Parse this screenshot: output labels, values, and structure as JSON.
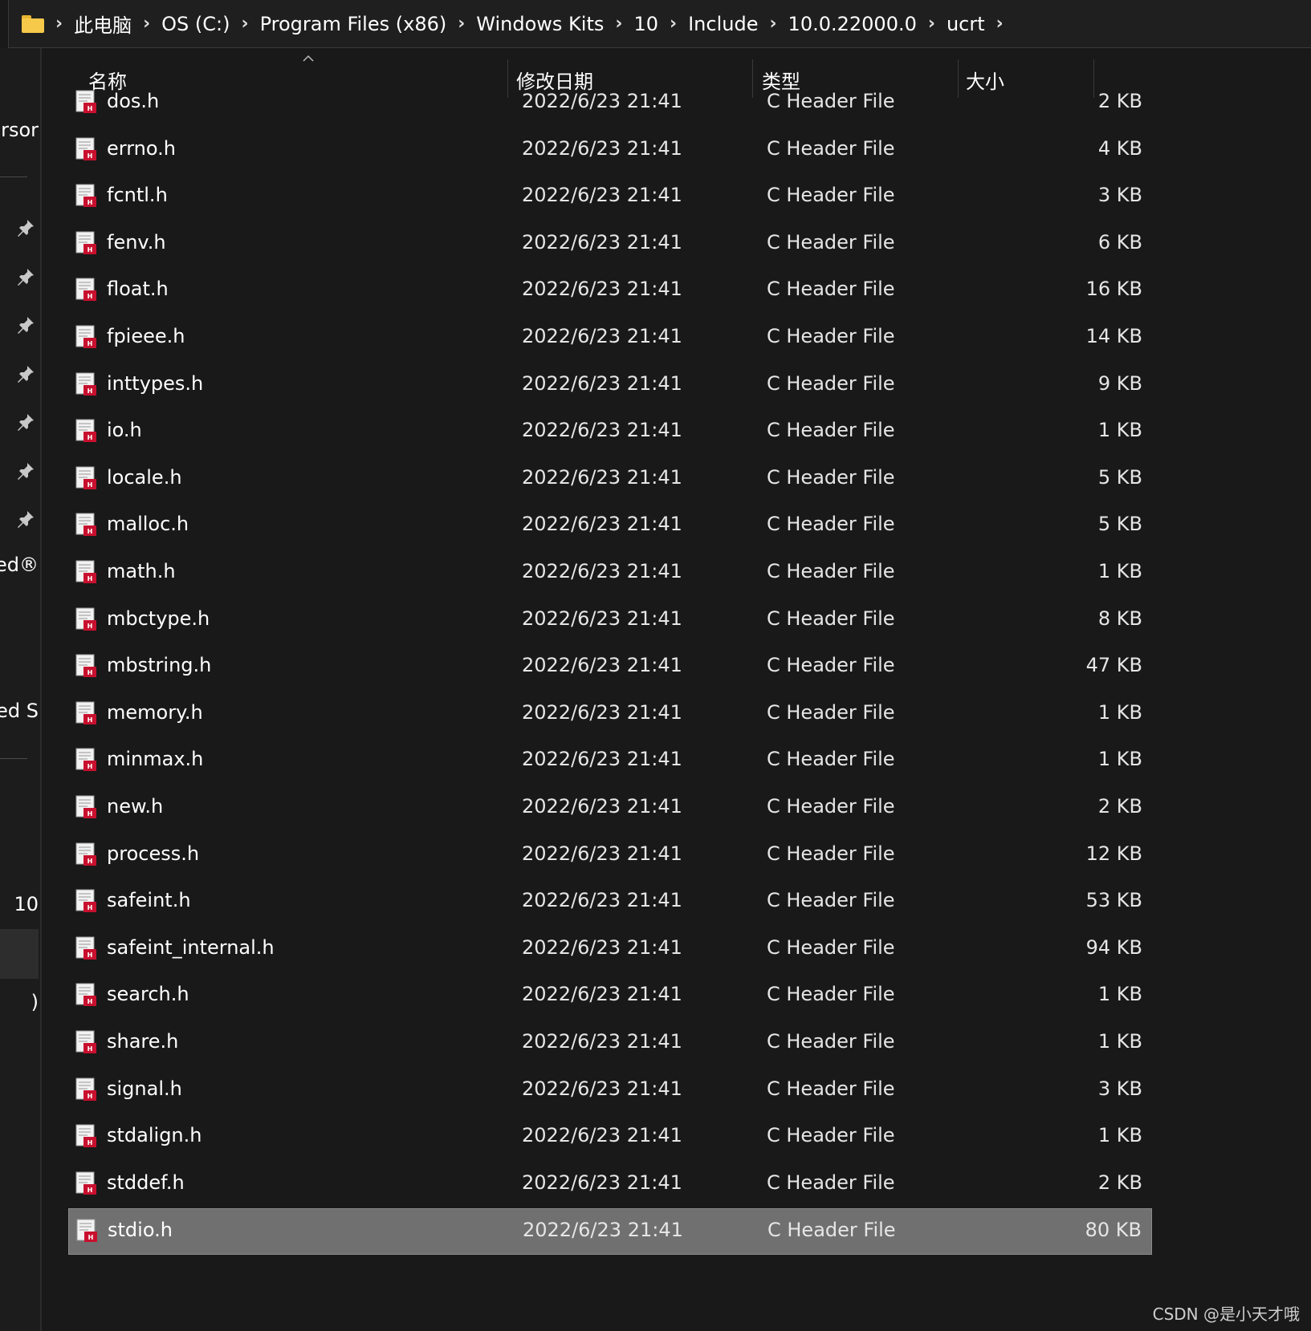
{
  "breadcrumb": [
    "此电脑",
    "OS (C:)",
    "Program Files (x86)",
    "Windows Kits",
    "10",
    "Include",
    "10.0.22000.0",
    "ucrt"
  ],
  "nav": {
    "texts": [
      "rsor",
      "ed®",
      "ed S",
      "10",
      ")"
    ],
    "pin_icons": [
      "pin-icon",
      "pin-icon",
      "pin-icon",
      "pin-icon",
      "pin-icon",
      "pin-icon",
      "pin-icon"
    ]
  },
  "columns": {
    "name": "名称",
    "date": "修改日期",
    "type": "类型",
    "size": "大小"
  },
  "files": [
    {
      "name": "dos.h",
      "date": "2022/6/23 21:41",
      "type": "C Header File",
      "size": "2 KB"
    },
    {
      "name": "errno.h",
      "date": "2022/6/23 21:41",
      "type": "C Header File",
      "size": "4 KB"
    },
    {
      "name": "fcntl.h",
      "date": "2022/6/23 21:41",
      "type": "C Header File",
      "size": "3 KB"
    },
    {
      "name": "fenv.h",
      "date": "2022/6/23 21:41",
      "type": "C Header File",
      "size": "6 KB"
    },
    {
      "name": "float.h",
      "date": "2022/6/23 21:41",
      "type": "C Header File",
      "size": "16 KB"
    },
    {
      "name": "fpieee.h",
      "date": "2022/6/23 21:41",
      "type": "C Header File",
      "size": "14 KB"
    },
    {
      "name": "inttypes.h",
      "date": "2022/6/23 21:41",
      "type": "C Header File",
      "size": "9 KB"
    },
    {
      "name": "io.h",
      "date": "2022/6/23 21:41",
      "type": "C Header File",
      "size": "1 KB"
    },
    {
      "name": "locale.h",
      "date": "2022/6/23 21:41",
      "type": "C Header File",
      "size": "5 KB"
    },
    {
      "name": "malloc.h",
      "date": "2022/6/23 21:41",
      "type": "C Header File",
      "size": "5 KB"
    },
    {
      "name": "math.h",
      "date": "2022/6/23 21:41",
      "type": "C Header File",
      "size": "1 KB"
    },
    {
      "name": "mbctype.h",
      "date": "2022/6/23 21:41",
      "type": "C Header File",
      "size": "8 KB"
    },
    {
      "name": "mbstring.h",
      "date": "2022/6/23 21:41",
      "type": "C Header File",
      "size": "47 KB"
    },
    {
      "name": "memory.h",
      "date": "2022/6/23 21:41",
      "type": "C Header File",
      "size": "1 KB"
    },
    {
      "name": "minmax.h",
      "date": "2022/6/23 21:41",
      "type": "C Header File",
      "size": "1 KB"
    },
    {
      "name": "new.h",
      "date": "2022/6/23 21:41",
      "type": "C Header File",
      "size": "2 KB"
    },
    {
      "name": "process.h",
      "date": "2022/6/23 21:41",
      "type": "C Header File",
      "size": "12 KB"
    },
    {
      "name": "safeint.h",
      "date": "2022/6/23 21:41",
      "type": "C Header File",
      "size": "53 KB"
    },
    {
      "name": "safeint_internal.h",
      "date": "2022/6/23 21:41",
      "type": "C Header File",
      "size": "94 KB"
    },
    {
      "name": "search.h",
      "date": "2022/6/23 21:41",
      "type": "C Header File",
      "size": "1 KB"
    },
    {
      "name": "share.h",
      "date": "2022/6/23 21:41",
      "type": "C Header File",
      "size": "1 KB"
    },
    {
      "name": "signal.h",
      "date": "2022/6/23 21:41",
      "type": "C Header File",
      "size": "3 KB"
    },
    {
      "name": "stdalign.h",
      "date": "2022/6/23 21:41",
      "type": "C Header File",
      "size": "1 KB"
    },
    {
      "name": "stddef.h",
      "date": "2022/6/23 21:41",
      "type": "C Header File",
      "size": "2 KB"
    },
    {
      "name": "stdio.h",
      "date": "2022/6/23 21:41",
      "type": "C Header File",
      "size": "80 KB",
      "selected": true
    }
  ],
  "watermark": "CSDN @是小天才哦",
  "colors": {
    "background": "#191919",
    "selected_row": "#707070",
    "folder": "#f6c94a",
    "file_icon_red": "#c8102e"
  }
}
